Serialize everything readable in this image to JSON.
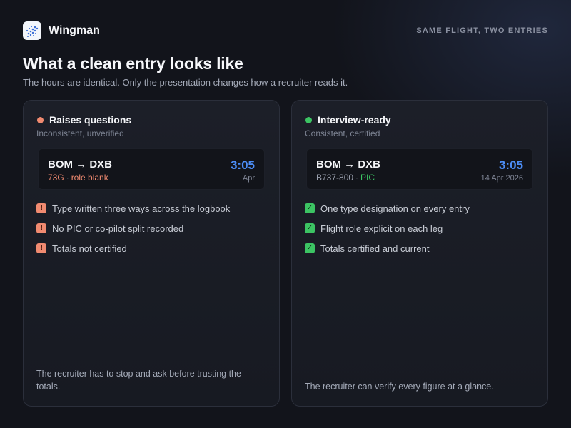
{
  "app": {
    "name": "Wingman",
    "tagline": "SAME FLIGHT, TWO ENTRIES"
  },
  "page": {
    "title": "What a clean entry looks like",
    "subtitle": "The hours are identical. Only the presentation changes how a recruiter reads it."
  },
  "cards": [
    {
      "title": "Raises questions",
      "subtitle": "Inconsistent, unverified",
      "status_color": "#f08a70",
      "entry": {
        "route": "BOM → DXB",
        "type": "73G",
        "role": "role blank",
        "time": "3:05",
        "date": "Apr"
      },
      "items": [
        "Type written three ways across the logbook",
        "No PIC or co-pilot split recorded",
        "Totals not certified"
      ],
      "item_icon": "warning-icon",
      "item_icon_glyph": "!",
      "note": "The recruiter has to stop and ask before trusting the totals."
    },
    {
      "title": "Interview-ready",
      "subtitle": "Consistent, certified",
      "status_color": "#3cc463",
      "entry": {
        "route": "BOM → DXB",
        "type": "B737-800",
        "role": "PIC",
        "time": "3:05",
        "date": "14 Apr 2026"
      },
      "items": [
        "One type designation on every entry",
        "Flight role explicit on each leg",
        "Totals certified and current"
      ],
      "item_icon": "check-icon",
      "item_icon_glyph": "✓",
      "note": "The recruiter can verify every figure at a glance."
    }
  ],
  "colors": {
    "accent_time": "#4c8df6",
    "warn": "#f08a70",
    "ok": "#3cc463",
    "background": "#12141b"
  }
}
